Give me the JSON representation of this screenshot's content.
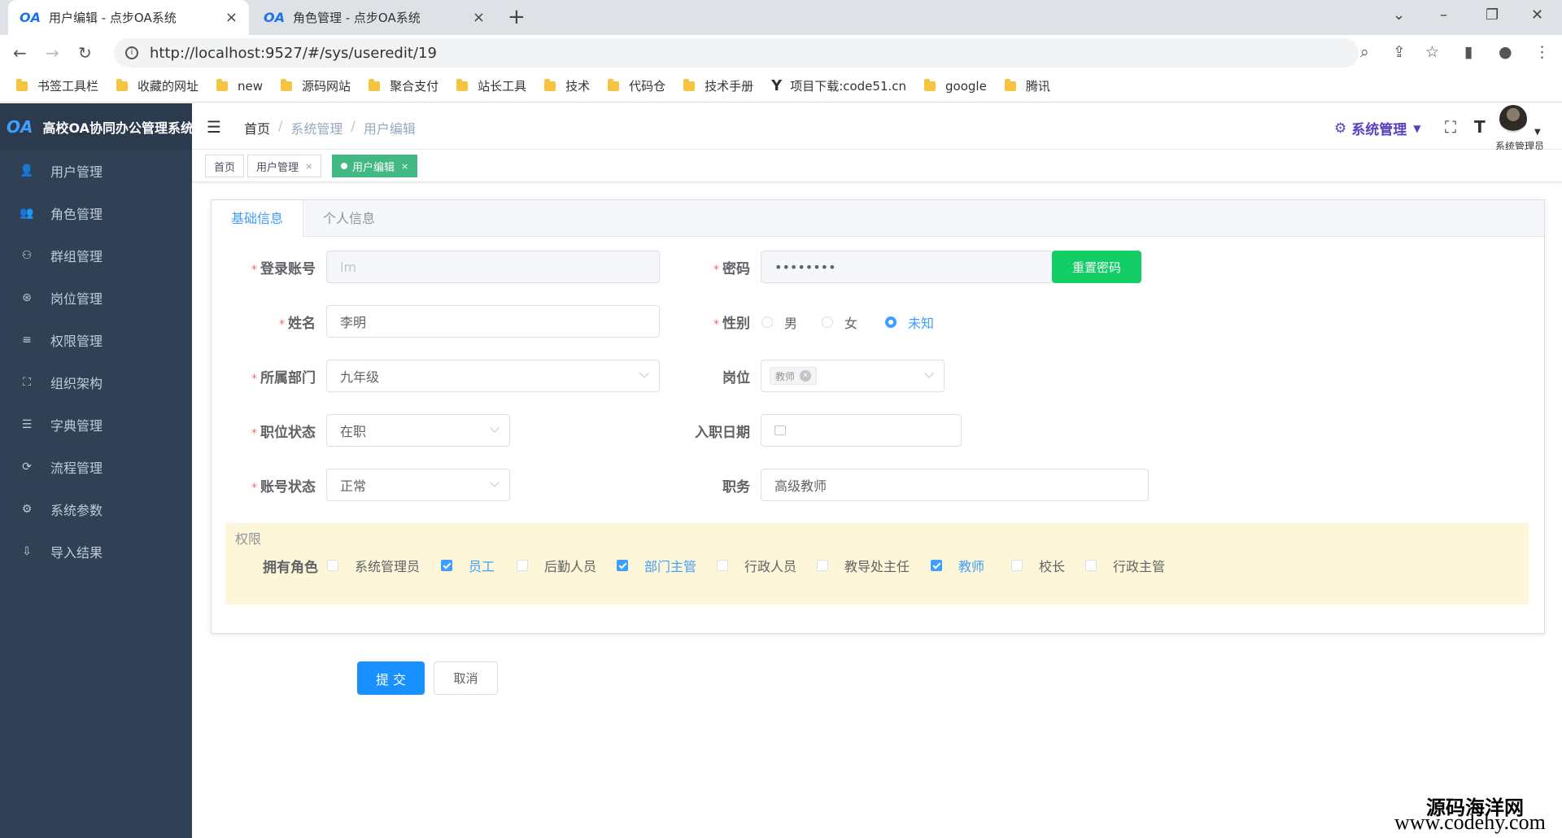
{
  "browser": {
    "tabs": [
      {
        "favicon": "OA",
        "title": "用户编辑 - 点步OA系统",
        "close": "×"
      },
      {
        "favicon": "OA",
        "title": "角色管理 - 点步OA系统",
        "close": "×"
      }
    ],
    "new_tab": "+",
    "url": "http://localhost:9527/#/sys/useredit/19",
    "bookmarks": [
      "书签工具栏",
      "收藏的网址",
      "new",
      "源码网站",
      "聚合支付",
      "站长工具",
      "技术",
      "代码仓",
      "技术手册",
      "项目下载:code51.cn",
      "google",
      "腾讯"
    ],
    "bookmark_logo": "Y"
  },
  "sidebar": {
    "logo_mark": "OA",
    "app_name": "高校OA协同办公管理系统",
    "items": [
      {
        "label": "用户管理",
        "icon": "user-icon"
      },
      {
        "label": "角色管理",
        "icon": "role-icon"
      },
      {
        "label": "群组管理",
        "icon": "group-icon"
      },
      {
        "label": "岗位管理",
        "icon": "post-icon"
      },
      {
        "label": "权限管理",
        "icon": "permission-icon"
      },
      {
        "label": "组织架构",
        "icon": "org-tree-icon"
      },
      {
        "label": "字典管理",
        "icon": "dictionary-icon"
      },
      {
        "label": "流程管理",
        "icon": "workflow-icon"
      },
      {
        "label": "系统参数",
        "icon": "settings-icon"
      },
      {
        "label": "导入结果",
        "icon": "import-icon"
      }
    ]
  },
  "header": {
    "breadcrumbs": [
      "首页",
      "系统管理",
      "用户编辑"
    ],
    "system_menu": "系统管理",
    "user_name": "系统管理员"
  },
  "tags": [
    {
      "label": "首页"
    },
    {
      "label": "用户管理",
      "close": "×"
    },
    {
      "label": "用户编辑",
      "close": "×"
    }
  ],
  "form": {
    "tabs": [
      "基础信息",
      "个人信息"
    ],
    "login_account": {
      "label": "登录账号",
      "value": "lm"
    },
    "password": {
      "label": "密码",
      "value": "••••••••",
      "reset_button": "重置密码"
    },
    "name": {
      "label": "姓名",
      "value": "李明"
    },
    "gender": {
      "label": "性别",
      "options": [
        "男",
        "女",
        "未知"
      ],
      "selected": "未知"
    },
    "department": {
      "label": "所属部门",
      "value": "九年级"
    },
    "post": {
      "label": "岗位",
      "tag": "教师"
    },
    "job_status": {
      "label": "职位状态",
      "value": "在职"
    },
    "hire_date": {
      "label": "入职日期",
      "value": ""
    },
    "account_status": {
      "label": "账号状态",
      "value": "正常"
    },
    "duty": {
      "label": "职务",
      "value": "高级教师"
    },
    "permissions": {
      "title": "权限",
      "roles_label": "拥有角色",
      "roles": [
        {
          "label": "系统管理员",
          "checked": false
        },
        {
          "label": "员工",
          "checked": true
        },
        {
          "label": "后勤人员",
          "checked": false
        },
        {
          "label": "部门主管",
          "checked": true
        },
        {
          "label": "行政人员",
          "checked": false
        },
        {
          "label": "教导处主任",
          "checked": false
        },
        {
          "label": "教师",
          "checked": true
        },
        {
          "label": "校长",
          "checked": false
        },
        {
          "label": "行政主管",
          "checked": false
        }
      ]
    },
    "submit": "提 交",
    "cancel": "取消"
  },
  "watermark": {
    "line1": "源码海洋网",
    "line2": "www.codehy.com"
  },
  "colors": {
    "primary": "#409eff",
    "sidebar": "#304156",
    "success": "#13ce66",
    "tag_active": "#42b983"
  }
}
